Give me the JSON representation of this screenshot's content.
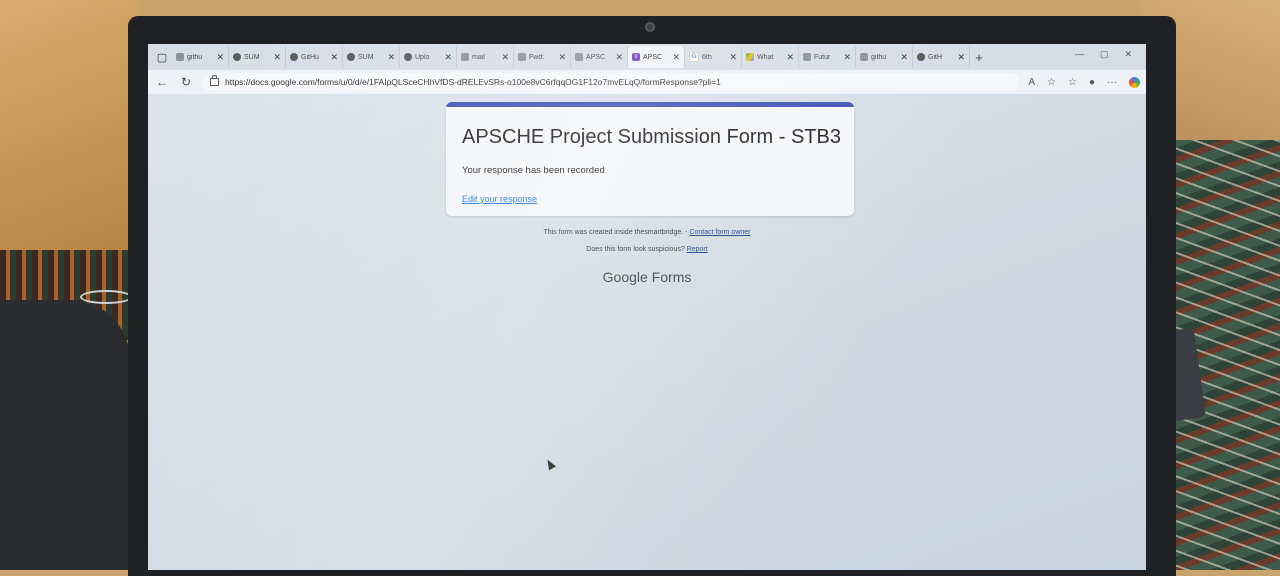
{
  "browser": {
    "tabs": [
      {
        "label": "githu",
        "icon": "generic-favicon"
      },
      {
        "label": "SUM",
        "icon": "github-icon"
      },
      {
        "label": "GitHu",
        "icon": "github-icon"
      },
      {
        "label": "SUM",
        "icon": "github-icon"
      },
      {
        "label": "Uplo",
        "icon": "github-icon"
      },
      {
        "label": "mail",
        "icon": "generic-favicon"
      },
      {
        "label": "Fwd:",
        "icon": "generic-favicon"
      },
      {
        "label": "APSC",
        "icon": "generic-favicon"
      },
      {
        "label": "APSC",
        "icon": "forms-icon",
        "active": true
      },
      {
        "label": "6th",
        "icon": "google-icon"
      },
      {
        "label": "What",
        "icon": "drive-icon"
      },
      {
        "label": "Futur",
        "icon": "generic-favicon"
      },
      {
        "label": "githu",
        "icon": "generic-favicon"
      },
      {
        "label": "GitH",
        "icon": "github-icon"
      }
    ],
    "url": "https://docs.google.com/forms/u/0/d/e/1FAIpQLSceCHhVfDS-dRELEvSRs-o100e8vC6rfqqOG1F12o7mvELqQ/formResponse?pli=1"
  },
  "form": {
    "title": "APSCHE Project Submission Form - STB3",
    "confirmation": "Your response has been recorded",
    "edit_link": "Edit your response"
  },
  "footer": {
    "created_text": "This form was created inside thesmartbridge. -",
    "contact_link": "Contact form owner",
    "suspicious_text": "Does this form look suspicious?",
    "report_link": "Report",
    "brand_google": "Google",
    "brand_forms": "Forms"
  }
}
